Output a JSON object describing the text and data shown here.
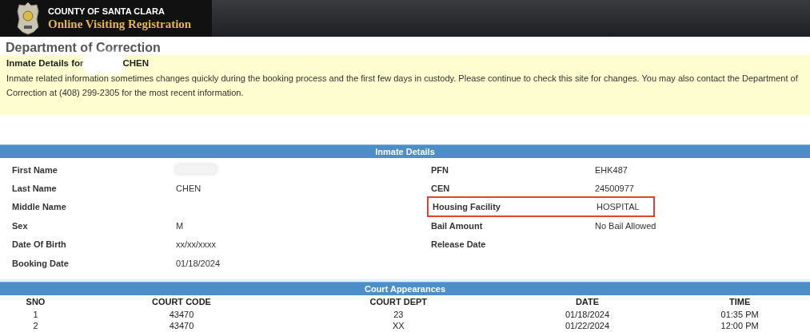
{
  "header": {
    "county": "COUNTY OF SANTA CLARA",
    "title": "Online Visiting Registration"
  },
  "department": "Department of Correction",
  "notice": {
    "heading_prefix": "Inmate Details for",
    "heading_name_redacted": true,
    "heading_suffix": "CHEN",
    "text": "Inmate related information sometimes changes quickly during the booking process and the first few days in custody. Please continue to check this site for changes. You may also contact the Department of Correction at (408) 299-2305 for the most recent information."
  },
  "inmate_details": {
    "title": "Inmate Details",
    "left": [
      {
        "label": "First Name",
        "redacted": true
      },
      {
        "label": "Last Name",
        "value": "CHEN",
        "redacted": false
      },
      {
        "label": "Middle Name",
        "redacted": false
      },
      {
        "label": "Sex",
        "value": "M",
        "redacted": false
      },
      {
        "label": "Date Of Birth",
        "value": "xx/xx/xxxx",
        "redacted": false
      },
      {
        "label": "Booking Date",
        "value": "01/18/2024",
        "redacted": false
      }
    ],
    "right": [
      {
        "label": "PFN",
        "value": "EHK487",
        "highlighted": false
      },
      {
        "label": "CEN",
        "value": "24500977",
        "highlighted": false
      },
      {
        "label": "Housing Facility",
        "value": "HOSPITAL",
        "highlighted": true
      },
      {
        "label": "Bail Amount",
        "value": "No Bail Allowed",
        "highlighted": false
      },
      {
        "label": "Release Date",
        "highlighted": false
      }
    ]
  },
  "court_appearances": {
    "title": "Court Appearances",
    "columns": [
      "SNO",
      "COURT CODE",
      "COURT DEPT",
      "DATE",
      "TIME"
    ],
    "rows": [
      [
        "1",
        "43470",
        "23",
        "01/18/2024",
        "01:35 PM"
      ],
      [
        "2",
        "43470",
        "XX",
        "01/22/2024",
        "12:00 PM"
      ]
    ]
  }
}
